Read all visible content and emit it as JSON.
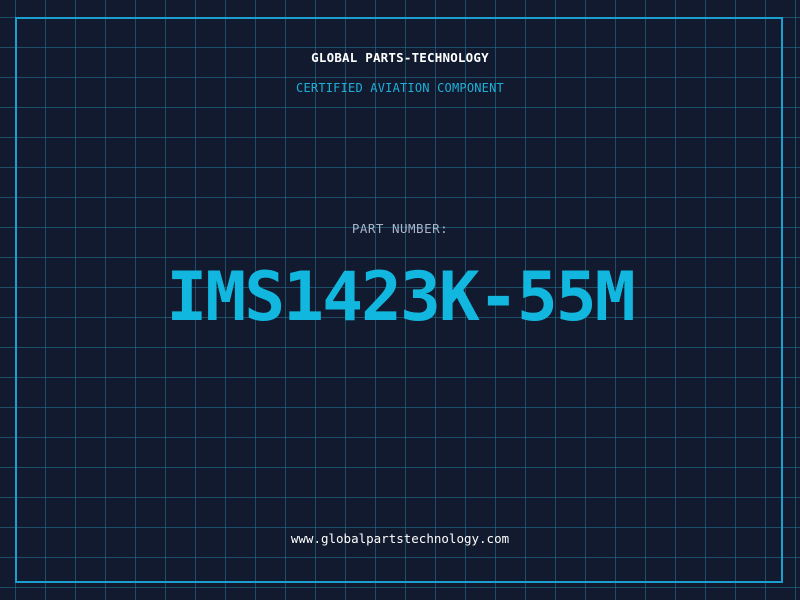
{
  "brand": {
    "title": "GLOBAL PARTS-TECHNOLOGY",
    "subtitle": "CERTIFIED AVIATION COMPONENT"
  },
  "part": {
    "label": "PART NUMBER:",
    "number": "IMS1423K-55M"
  },
  "footer": {
    "website": "www.globalpartstechnology.com"
  },
  "colors": {
    "background": "#111a2e",
    "grid": "#26789b",
    "accent": "#12b7df",
    "frame": "#1a9fcf",
    "label": "#a8b4c8",
    "text": "#ffffff"
  }
}
